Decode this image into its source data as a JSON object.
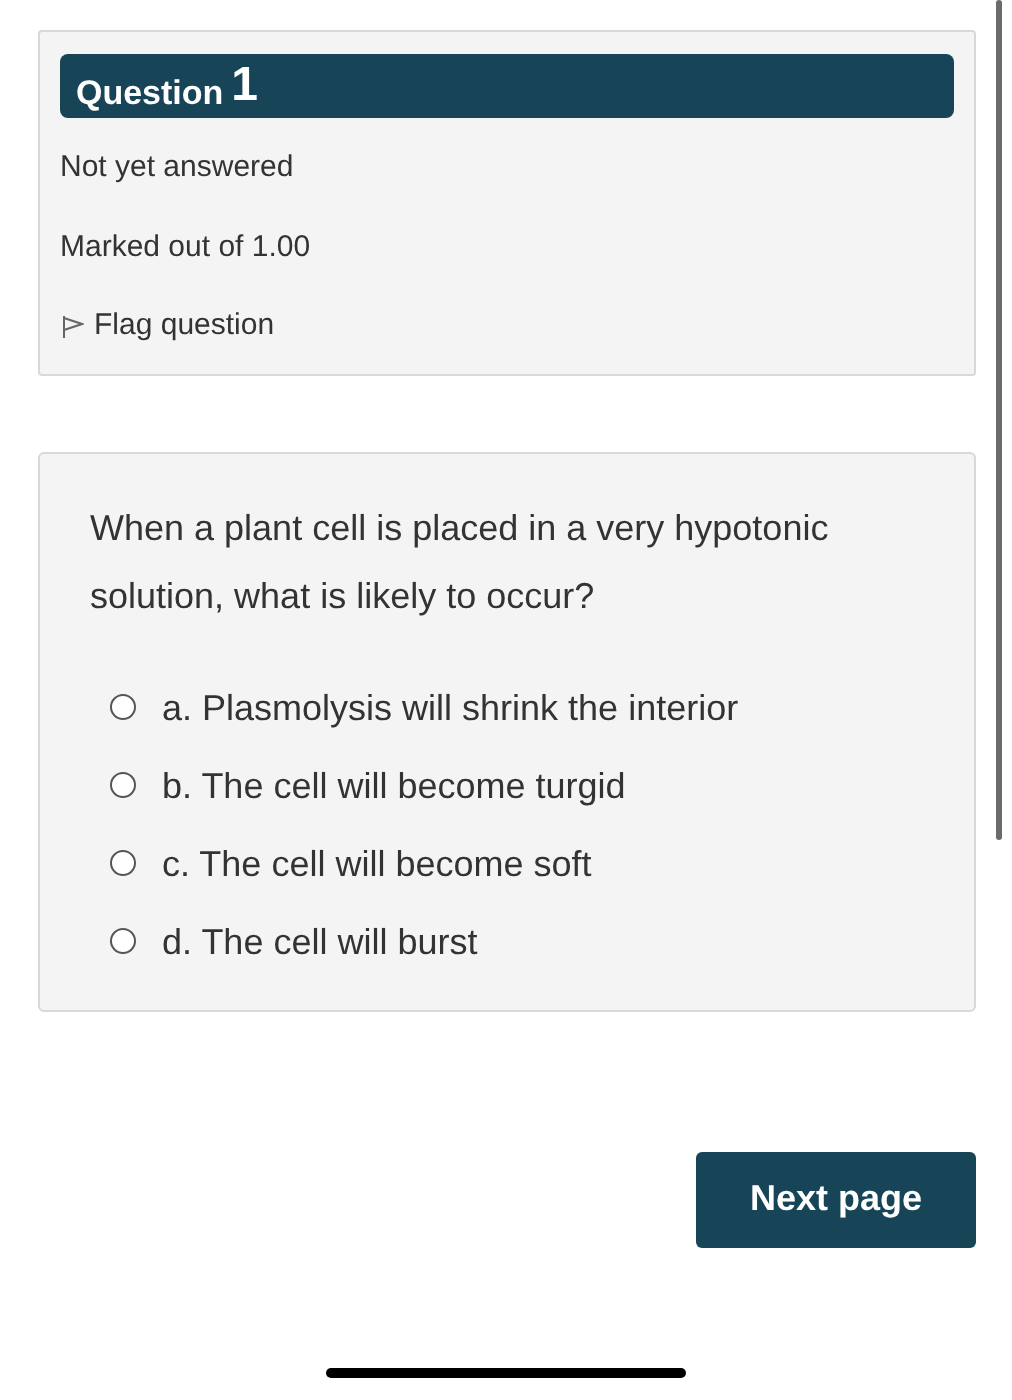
{
  "info": {
    "label": "Question",
    "number": "1",
    "status": "Not yet answered",
    "marks": "Marked out of 1.00",
    "flag": {
      "label": "Flag question",
      "flagged": false
    }
  },
  "question": {
    "text": "When a plant cell is placed in a very hypotonic solution, what is likely to occur?",
    "options": [
      {
        "label": "a. Plasmolysis will shrink the interior",
        "selected": false
      },
      {
        "label": "b. The cell will become turgid",
        "selected": false
      },
      {
        "label": "c. The cell will become soft",
        "selected": false
      },
      {
        "label": "d. The cell will burst",
        "selected": false
      }
    ]
  },
  "next_button": "Next page"
}
